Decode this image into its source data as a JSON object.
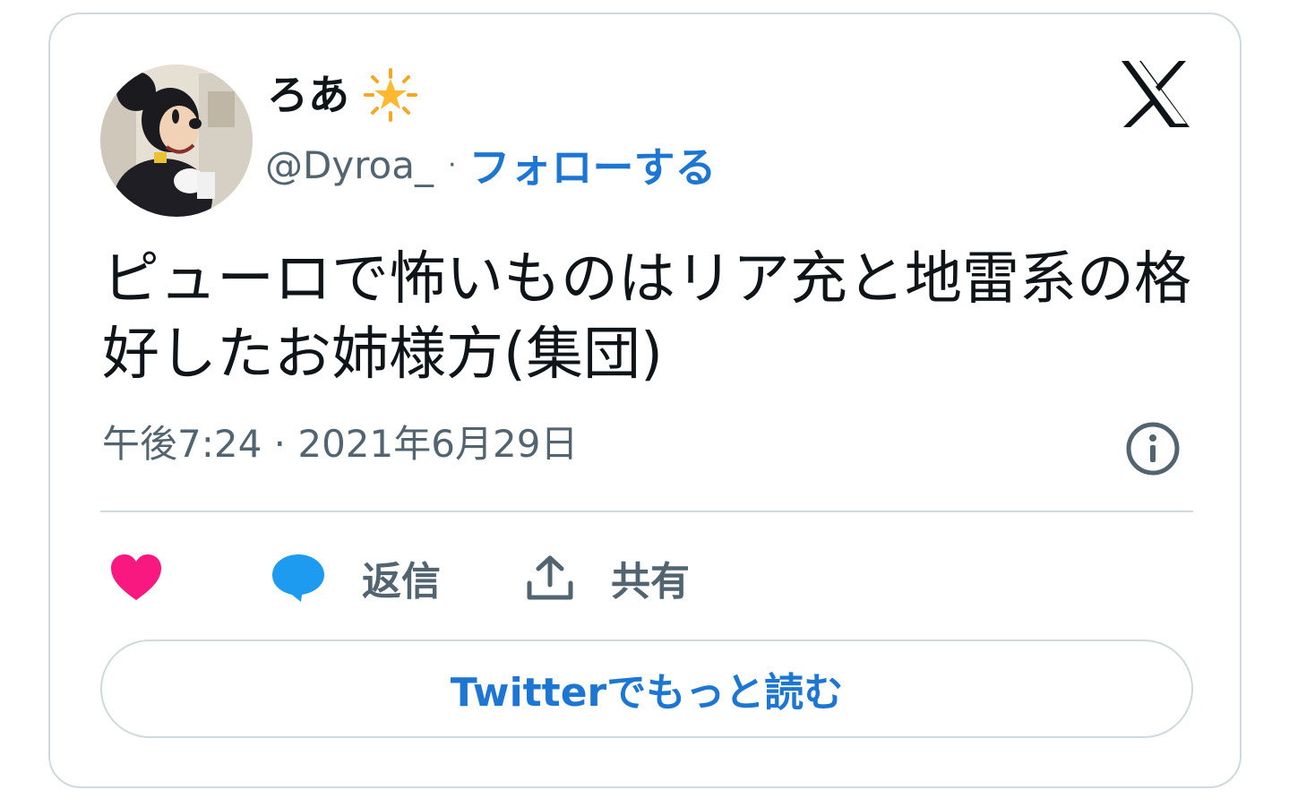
{
  "user": {
    "display_name": "ろあ",
    "badge_icon": "sparkle-star-emoji",
    "handle": "@Dyroa_",
    "separator": "·",
    "follow_label": "フォローする",
    "avatar_desc": "avatar"
  },
  "brand": {
    "logo_icon": "x-logo-icon"
  },
  "tweet": {
    "text": "ピューロで怖いものはリア充と地雷系の格好したお姉様方(集団)",
    "timestamp": "午後7:24 · 2021年6月29日"
  },
  "actions": {
    "like_icon": "heart-icon",
    "reply_icon": "speech-bubble-icon",
    "reply_label": "返信",
    "share_icon": "share-upload-icon",
    "share_label": "共有"
  },
  "read_more_label": "Twitterでもっと読む",
  "colors": {
    "link_blue": "#1d77d2",
    "heart_pink": "#f91880",
    "reply_blue": "#1d9bf0",
    "muted_gray": "#536471",
    "text_dark": "#0f1419",
    "border": "#cfd9de"
  }
}
